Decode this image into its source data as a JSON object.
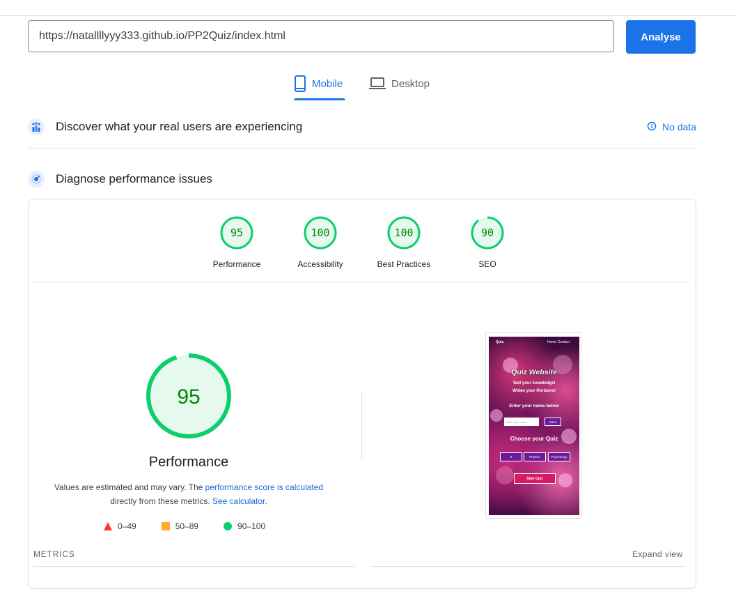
{
  "search": {
    "url_value": "https://natallllyyy333.github.io/PP2Quiz/index.html",
    "analyse_label": "Analyse"
  },
  "tabs": [
    {
      "label": "Mobile",
      "active": true,
      "icon": "phone-icon"
    },
    {
      "label": "Desktop",
      "active": false,
      "icon": "laptop-icon"
    }
  ],
  "field_section": {
    "title": "Discover what your real users are experiencing",
    "status": "No data",
    "icon": "users-chart-icon"
  },
  "lab_section": {
    "title": "Diagnose performance issues",
    "icon": "lighthouse-icon"
  },
  "categories": [
    {
      "label": "Performance",
      "score": "95"
    },
    {
      "label": "Accessibility",
      "score": "100"
    },
    {
      "label": "Best Practices",
      "score": "100"
    },
    {
      "label": "SEO",
      "score": "90"
    }
  ],
  "performance": {
    "score": "95",
    "title": "Performance",
    "desc_pre": "Values are estimated and may vary. The ",
    "desc_link": "performance score is calculated",
    "desc_mid": "directly from these metrics. ",
    "desc_link2": "See calculator",
    "desc_end": "."
  },
  "legend": [
    {
      "range": "0–49",
      "color": "#ff3333",
      "shape": "triangle"
    },
    {
      "range": "50–89",
      "color": "#ffaa33",
      "shape": "square"
    },
    {
      "range": "90–100",
      "color": "#0cce6b",
      "shape": "circle"
    }
  ],
  "screenshot": {
    "brand": "Quiz.",
    "nav": "Home  Contact",
    "title": "Quiz Website",
    "tagline1": "Test your knowledge!",
    "tagline2": "Widen your Horizons!",
    "name_heading": "Enter your name below",
    "name_placeholder": "Enter your name",
    "save": "Save",
    "choose_heading": "Choose your Quiz",
    "quiz_it": "IT",
    "quiz_physics": "Physics",
    "quiz_psychology": "Psychology",
    "start": "Start Quiz"
  },
  "metrics": {
    "label": "METRICS",
    "expand": "Expand view"
  },
  "colors": {
    "accent": "#1a73e8",
    "pass": "#0cce6b",
    "pass_text": "#008800",
    "pass_fill": "#e6f9ee"
  }
}
